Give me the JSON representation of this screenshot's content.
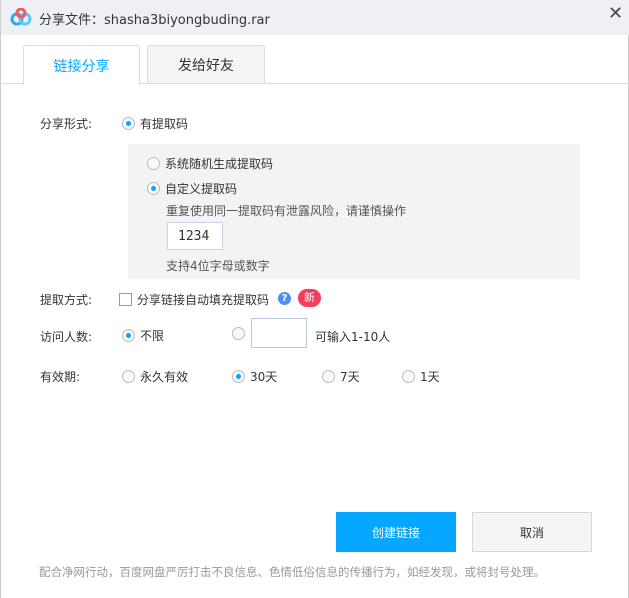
{
  "title": "分享文件：shasha3biyongbuding.rar",
  "tabs": [
    {
      "label": "链接分享",
      "active": true
    },
    {
      "label": "发给好友",
      "active": false
    }
  ],
  "share_form": {
    "label": "分享形式:",
    "option": "有提取码",
    "random": "系统随机生成提取码",
    "custom": "自定义提取码",
    "warning": "重复使用同一提取码有泄露风险，请谨慎操作",
    "code": "1234",
    "hint": "支持4位字母或数字"
  },
  "extract": {
    "label": "提取方式:",
    "checkbox": "分享链接自动填充提取码",
    "badge": "新"
  },
  "visitors": {
    "label": "访问人数:",
    "unlimited": "不限",
    "value": "",
    "hint": "可输入1-10人"
  },
  "validity": {
    "label": "有效期:",
    "options": [
      "永久有效",
      "30天",
      "7天",
      "1天"
    ],
    "selected": 1
  },
  "buttons": {
    "create": "创建链接",
    "cancel": "取消"
  },
  "footer": "配合净网行动，百度网盘严厉打击不良信息、色情低俗信息的传播行为，如经发现，或将封号处理。",
  "colors": {
    "accent": "#06a7ff",
    "badge": "#f23d5d"
  }
}
